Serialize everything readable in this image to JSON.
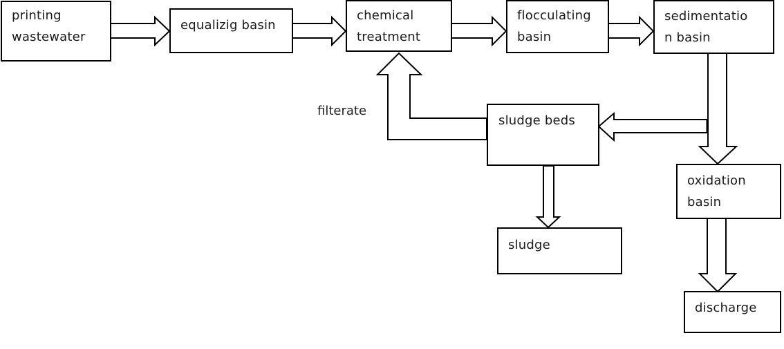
{
  "diagram": {
    "type": "process-flowchart",
    "nodes": {
      "printing_wastewater": {
        "line1": "printing",
        "line2": "wastewater"
      },
      "equalizing_basin": {
        "line1": "equalizig basin"
      },
      "chemical_treatment": {
        "line1": "chemical",
        "line2": "treatment"
      },
      "flocculating_basin": {
        "line1": "flocculating",
        "line2": "basin"
      },
      "sedimentation_basin": {
        "line1": "sedimentatio",
        "line2": "n basin"
      },
      "sludge_beds": {
        "line1": "sludge beds"
      },
      "oxidation_basin": {
        "line1": "oxidation",
        "line2": "basin"
      },
      "sludge": {
        "line1": "sludge"
      },
      "discharge": {
        "line1": "discharge"
      }
    },
    "edge_labels": {
      "filterate": "filterate"
    },
    "edges": [
      {
        "from": "printing wastewater",
        "to": "equalizig basin"
      },
      {
        "from": "equalizig basin",
        "to": "chemical treatment"
      },
      {
        "from": "chemical treatment",
        "to": "flocculating basin"
      },
      {
        "from": "flocculating basin",
        "to": "sedimentation basin"
      },
      {
        "from": "sedimentation basin",
        "to": "oxidation basin"
      },
      {
        "from": "sedimentation basin",
        "to": "sludge beds"
      },
      {
        "from": "sludge beds",
        "to": "chemical treatment",
        "label": "filterate"
      },
      {
        "from": "sludge beds",
        "to": "sludge"
      },
      {
        "from": "oxidation basin",
        "to": "discharge"
      }
    ]
  }
}
